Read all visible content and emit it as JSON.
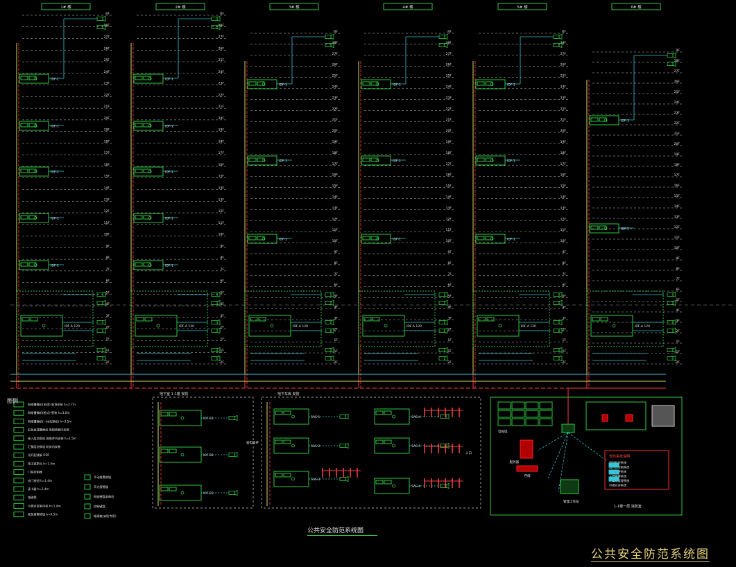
{
  "drawing": {
    "main_title": "公共安全防范系统图",
    "sub_title": "公共安全防范系统图",
    "legend_heading": "图例",
    "room_label": "1-1楼一层 消防室"
  },
  "columns": [
    {
      "header": "1# 楼"
    },
    {
      "header": "2# 楼"
    },
    {
      "header": "3# 楼"
    },
    {
      "header": "4# 楼"
    },
    {
      "header": "5# 楼"
    },
    {
      "header": "6# 楼"
    }
  ],
  "floors_short": [
    "RF",
    "28F",
    "27F",
    "26F",
    "25F",
    "24F",
    "23F",
    "22F",
    "21F",
    "20F",
    "19F",
    "18F",
    "17F",
    "16F",
    "15F",
    "14F",
    "13F",
    "12F",
    "11F",
    "10F",
    "9F",
    "8F",
    "7F",
    "6F",
    "5F",
    "4F",
    "3F",
    "2F",
    "1F",
    "-1F",
    "-2F"
  ],
  "floors_tall": [
    "RF",
    "28F",
    "27F",
    "26F",
    "25F",
    "24F",
    "23F",
    "22F",
    "21F",
    "20F",
    "19F",
    "18F",
    "17F",
    "16F",
    "15F",
    "14F",
    "13F",
    "12F",
    "11F",
    "10F",
    "9F",
    "8F",
    "7F",
    "6F",
    "5F",
    "4F",
    "3F",
    "2F",
    "1F",
    "-1F",
    "-2F"
  ],
  "switch_labels": {
    "floor": "IDF-1",
    "core": "IDF-A 120"
  },
  "basement_panel": {
    "title": "地下室 1-1楼 安防",
    "units": [
      "IDF-B1",
      "IDF-B2",
      "IDF-B3"
    ],
    "side_text": "弱电竖井"
  },
  "parking_panel": {
    "title": "地下车库 安防",
    "units": [
      "SAS-1",
      "SAS-2",
      "SAS-3",
      "SAS-4",
      "SAS-5",
      "SAS-6"
    ],
    "side_text": "入口"
  },
  "legend": [
    "网络摄像机(半球) 吸顶安装 h=2.7m",
    "网络摄像机(枪式) 壁装 h=3.0m",
    "网络摄像机(一体化球机) h=3.5m",
    "彩色高清摄像机 电梯轿厢内安装",
    "接入层交换机 弱电井内安装 h=1.5m",
    "汇聚层交换机 机房内安装",
    "光纤配线架 ODF",
    "电子巡更点 h=1.4m",
    "门禁控制器",
    "出门按钮 h=1.4m",
    "读卡器 h=1.4m",
    "电磁锁",
    "可视对讲室内机 h=1.4m",
    "紧急报警按钮 h=0.5m"
  ],
  "legend_right": [
    "手动报警按钮",
    "声光报警器",
    "网络硬盘录像机",
    "控制键盘",
    "电源箱(安防专用)"
  ],
  "control_room": {
    "monitor_wall": "电视墙",
    "server": "服务器",
    "storage": "存储",
    "workstation": "管理工作站",
    "note_title": "安防系统说明",
    "notes": [
      "视频监控系统",
      "出入口控制系统",
      "电子巡更系统",
      "入侵报警系统",
      "停车场管理系统",
      "可视对讲系统"
    ]
  },
  "colors": {
    "background": "#000000",
    "box": "#2ecc40",
    "trunk": "#d8d86a",
    "fiber": "#ff3b3b",
    "cable": "#37c5d6",
    "text": "#e6e6e6",
    "floor_line": "#c8c8c8",
    "title": "#e7d37a"
  }
}
